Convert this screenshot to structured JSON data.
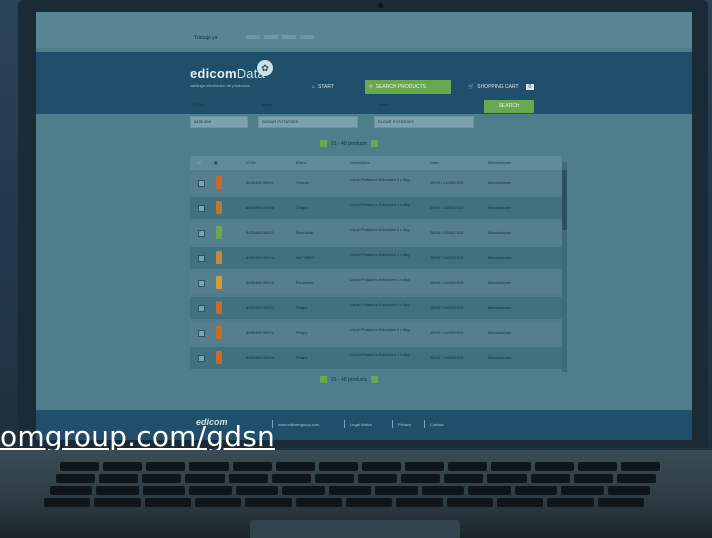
{
  "top_strip": {
    "label": "Trabaja ya"
  },
  "header": {
    "logo_main": "edicom",
    "logo_data": "Data",
    "tagline": "catálogo electrónico de productos",
    "nav": {
      "start": "START",
      "search": "SEARCH PRODUCTS",
      "cart": "SHOPPING CART",
      "cart_count": "0"
    }
  },
  "form": {
    "field1_label": "GTIN",
    "field1_value": "8435 498",
    "field2_label": "Brand",
    "field2_value": "SUGAR POTATOES",
    "field3_label": "Name",
    "field3_value": "ELGAR POTATOES",
    "search_button": "SEARCH"
  },
  "pager": {
    "text": "21 - 40 products"
  },
  "table": {
    "columns": [
      "GTIN",
      "Brand",
      "Description",
      "Date",
      "Manufacturer"
    ],
    "rows": [
      {
        "gtin": "8435498 00002",
        "brand": "Cheros",
        "desc": "Liquid Potatoes Extracted 4 x 6kg",
        "date": "28/09 / 15/05/2015",
        "mfr": "Manufacturer",
        "thumb": "#c86b2a"
      },
      {
        "gtin": "8435498 00008",
        "brand": "Chapo",
        "desc": "Liquid Potatoes Extracted 4 x 6kg",
        "date": "28/09 / 15/05/2015",
        "mfr": "Manufacturer",
        "thumb": "#b9772f"
      },
      {
        "gtin": "8435498 00010",
        "brand": "Rendalde",
        "desc": "Liquid Potatoes Extracted 4 x 6kg",
        "date": "28/09 / 15/05/2015",
        "mfr": "Manufacturer",
        "thumb": "#6aa84f"
      },
      {
        "gtin": "8435498 00014",
        "brand": "NATURES",
        "desc": "Liquid Potatoes Extracted 4 x 6kg",
        "date": "28/09 / 15/05/2015",
        "mfr": "Manufacturer",
        "thumb": "#c4883a"
      },
      {
        "gtin": "8435498 00016",
        "brand": "Escarabo",
        "desc": "Liquid Potatoes Extracted 4 x 6kg",
        "date": "28/09 / 15/05/2015",
        "mfr": "Manufacturer",
        "thumb": "#d69a3a"
      },
      {
        "gtin": "8435498 00020",
        "brand": "Peapy",
        "desc": "Liquid Potatoes Extracted 4 x 6kg",
        "date": "28/09 / 15/05/2015",
        "mfr": "Manufacturer",
        "thumb": "#c86b2a"
      },
      {
        "gtin": "8435498 00022",
        "brand": "Peapy",
        "desc": "Liquid Potatoes Extracted 4 x 6kg",
        "date": "28/09 / 15/05/2015",
        "mfr": "Manufacturer",
        "thumb": "#c86b2a"
      },
      {
        "gtin": "8435498 00024",
        "brand": "Peapy",
        "desc": "Liquid Potatoes Extracted 4 x 6kg",
        "date": "28/09 / 15/05/2015",
        "mfr": "Manufacturer",
        "thumb": "#c86b2a"
      }
    ]
  },
  "footer": {
    "logo": "edicom",
    "links": [
      "www.edicomgroup.com",
      "Legal Notice",
      "Privacy",
      "Contact"
    ]
  },
  "overlay_url": "omgroup.com/gdsn"
}
